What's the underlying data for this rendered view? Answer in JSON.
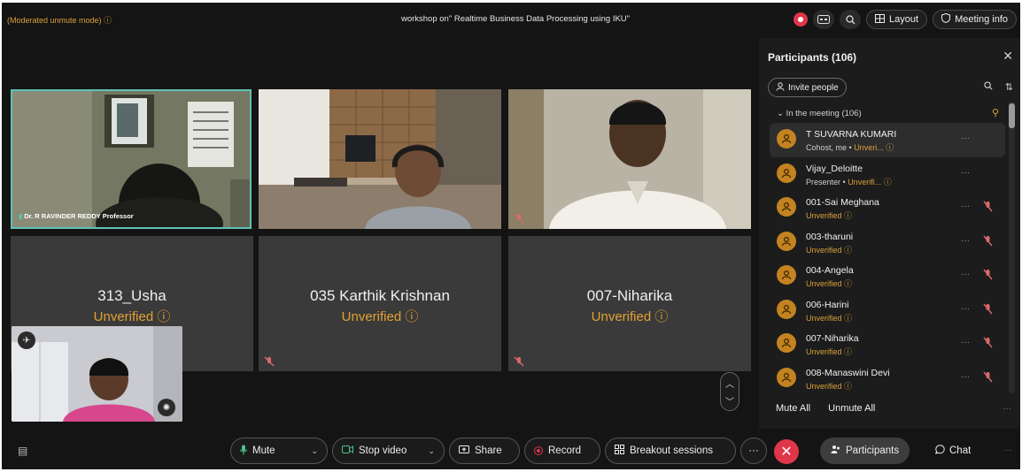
{
  "topbar": {
    "mode_text": "(Moderated unmute mode)",
    "title": "workshop on\" Realtime Business Data Processing using IKU\"",
    "layout_label": "Layout",
    "meeting_info_label": "Meeting info"
  },
  "videos": [
    {
      "caption": "Dr. R RAVINDER REDDY Professor"
    },
    {
      "caption": ""
    },
    {
      "caption": ""
    }
  ],
  "tiles": [
    {
      "name": "313_Usha",
      "status": "Unverified"
    },
    {
      "name": "035 Karthik Krishnan",
      "status": "Unverified"
    },
    {
      "name": "007-Niharika",
      "status": "Unverified"
    }
  ],
  "panel": {
    "title": "Participants (106)",
    "invite_label": "Invite people",
    "section_label": "In the meeting (106)",
    "mute_all": "Mute All",
    "unmute_all": "Unmute All",
    "participants": [
      {
        "name": "T SUVARNA KUMARI",
        "role": "Cohost, me",
        "status": "Unveri...",
        "muted": false
      },
      {
        "name": "Vijay_Deloitte",
        "role": "Presenter",
        "status": "Unverifi...",
        "muted": false
      },
      {
        "name": "001-Sai Meghana",
        "role": "",
        "status": "Unverified",
        "muted": true
      },
      {
        "name": "003-tharuni",
        "role": "",
        "status": "Unverified",
        "muted": true
      },
      {
        "name": "004-Angela",
        "role": "",
        "status": "Unverified",
        "muted": true
      },
      {
        "name": "006-Harini",
        "role": "",
        "status": "Unverified",
        "muted": true
      },
      {
        "name": "007-Niharika",
        "role": "",
        "status": "Unverified",
        "muted": true
      },
      {
        "name": "008-Manaswini Devi",
        "role": "",
        "status": "Unverified",
        "muted": true
      }
    ]
  },
  "toolbar": {
    "mute": "Mute",
    "stop_video": "Stop video",
    "share": "Share",
    "record": "Record",
    "breakout": "Breakout sessions",
    "participants": "Participants",
    "chat": "Chat"
  },
  "colors": {
    "accent": "#d9a23a",
    "danger": "#e0364a",
    "tile_bg": "#3a3a3a",
    "background": "#141414"
  }
}
